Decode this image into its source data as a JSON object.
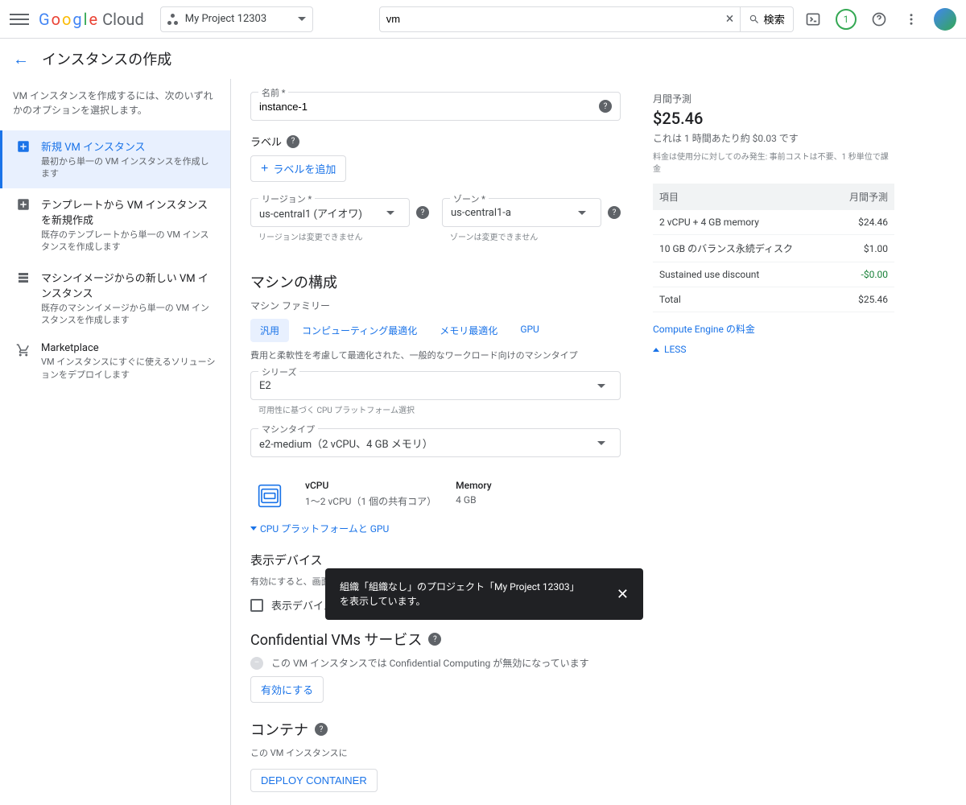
{
  "topbar": {
    "logo_cloud": "Cloud",
    "project_name": "My Project 12303",
    "search_value": "vm",
    "search_btn": "検索",
    "badge_count": "1"
  },
  "page": {
    "title": "インスタンスの作成",
    "intro": "VM インスタンスを作成するには、次のいずれかのオプションを選択します。"
  },
  "sidebar": [
    {
      "title": "新規 VM インスタンス",
      "desc": "最初から単一の VM インスタンスを作成します"
    },
    {
      "title": "テンプレートから VM インスタンスを新規作成",
      "desc": "既存のテンプレートから単一の VM インスタンスを作成します"
    },
    {
      "title": "マシンイメージからの新しい VM インスタンス",
      "desc": "既存のマシンイメージから単一の VM インスタンスを作成します"
    },
    {
      "title": "Marketplace",
      "desc": "VM インスタンスにすぐに使えるソリューションをデプロイします"
    }
  ],
  "form": {
    "name_label": "名前 *",
    "name_value": "instance-1",
    "labels_label": "ラベル",
    "add_label_btn": "ラベルを追加",
    "region_label": "リージョン *",
    "region_value": "us-central1 (アイオワ)",
    "region_hint": "リージョンは変更できません",
    "zone_label": "ゾーン *",
    "zone_value": "us-central1-a",
    "zone_hint": "ゾーンは変更できません",
    "machine_section": "マシンの構成",
    "machine_family_label": "マシン ファミリー",
    "tabs": [
      "汎用",
      "コンピューティング最適化",
      "メモリ最適化",
      "GPU"
    ],
    "family_desc": "費用と柔軟性を考慮して最適化された、一般的なワークロード向けのマシンタイプ",
    "series_label": "シリーズ",
    "series_value": "E2",
    "series_hint": "可用性に基づく CPU プラットフォーム選択",
    "machine_type_label": "マシンタイプ",
    "machine_type_value": "e2-medium（2 vCPU、4 GB メモリ）",
    "vcpu_h": "vCPU",
    "vcpu_v": "1～2 vCPU（1 個の共有コア）",
    "mem_h": "Memory",
    "mem_v": "4 GB",
    "cpu_platform_link": "CPU プラットフォームと GPU",
    "display_section": "表示デバイス",
    "display_desc": "有効にすると、画面キャプチャ ツールと録画ツールを使用できます。",
    "display_checkbox": "表示デバイスを有効にする",
    "confidential_section": "Confidential VMs サービス",
    "confidential_desc": "この VM インスタンスでは Confidential Computing が無効になっています",
    "enable_btn": "有効にする",
    "container_section": "コンテナ",
    "container_desc": "この VM インスタンスに",
    "deploy_btn": "DEPLOY CONTAINER"
  },
  "cost": {
    "title": "月間予測",
    "price": "$25.46",
    "sub": "これは 1 時間あたり約 $0.03 です",
    "note": "料金は使用分に対してのみ発生: 事前コストは不要、1 秒単位で課金",
    "th1": "項目",
    "th2": "月間予測",
    "rows": [
      {
        "item": "2 vCPU + 4 GB memory",
        "val": "$24.46"
      },
      {
        "item": "10 GB のバランス永続ディスク",
        "val": "$1.00"
      },
      {
        "item": "Sustained use discount",
        "val": "-$0.00"
      },
      {
        "item": "Total",
        "val": "$25.46"
      }
    ],
    "link": "Compute Engine の料金",
    "less": "LESS"
  },
  "toast": {
    "text": "組織「組織なし」のプロジェクト「My Project 12303」を表示しています。"
  }
}
